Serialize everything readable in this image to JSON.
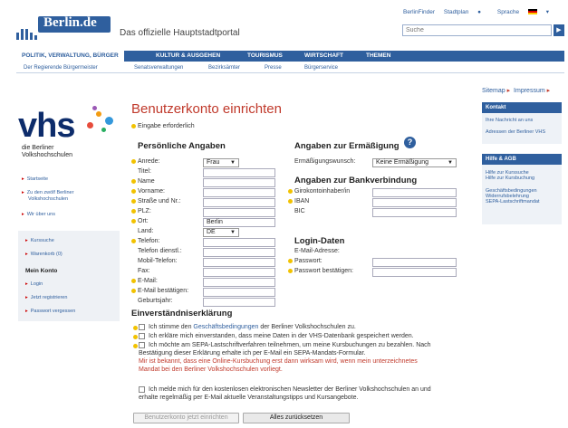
{
  "header": {
    "logo_text": "Berlin.de",
    "portal_title": "Das offizielle Hauptstadtportal",
    "util": {
      "berlinfinder": "BerlinFinder",
      "stadtplan": "Stadtplan",
      "sprache": "Sprache"
    },
    "search_placeholder": "Suche"
  },
  "nav_main": [
    "POLITIK, VERWALTUNG, BÜRGER",
    "KULTUR & AUSGEHEN",
    "TOURISMUS",
    "WIRTSCHAFT",
    "THEMEN"
  ],
  "nav_sub": [
    "Der Regierende Bürgermeister",
    "Senatsverwaltungen",
    "Bezirksämter",
    "Presse",
    "Bürgerservice"
  ],
  "left": {
    "logo": "vhs",
    "sub1": "die Berliner",
    "sub2": "Volkshochschulen",
    "links": [
      "Startseite",
      "Zu den zwölf Berliner",
      "Volkshochschulen",
      "Wir über uns"
    ],
    "links2": [
      "Kurssuche",
      "Warenkorb (0)"
    ],
    "konto_head": "Mein Konto",
    "konto_links": [
      "Login",
      "Jetzt registrieren",
      "Passwort vergessen"
    ]
  },
  "right": {
    "sitemap": "Sitemap",
    "impressum": "Impressum",
    "kontakt_head": "Kontakt",
    "kontakt_links": [
      "Ihre Nachricht an uns",
      "Adressen der Berliner VHS"
    ],
    "hilfe_head": "Hilfe & AGB",
    "hilfe_links": [
      "Hilfe zur Kurssuche",
      "Hilfe zur Kursbuchung",
      "Geschäftsbedingungen",
      "Widerrufsbelehrung",
      "SEPA-Lastschriftmandat"
    ]
  },
  "main": {
    "title": "Benutzerkonto einrichten",
    "required_note": "Eingabe erforderlich",
    "personal": {
      "title": "Persönliche Angaben",
      "anrede": "Anrede:",
      "anrede_value": "Frau",
      "titel": "Titel:",
      "name": "Name",
      "vorname": "Vorname:",
      "strasse": "Straße und Nr.:",
      "plz": "PLZ:",
      "ort": "Ort:",
      "ort_value": "Berlin",
      "land": "Land:",
      "land_value": "DE",
      "telefon": "Telefon:",
      "telefon_dienst": "Telefon dienstl.:",
      "mobil": "Mobil-Telefon:",
      "fax": "Fax:",
      "email": "E-Mail:",
      "email_confirm": "E-Mail bestätigen:",
      "geburt": "Geburtsjahr:"
    },
    "ermaessigung": {
      "title": "Angaben zur Ermäßigung",
      "label": "Ermäßigungswunsch:",
      "value": "Keine Ermäßigung"
    },
    "bank": {
      "title": "Angaben zur Bankverbindung",
      "inhaber": "Girokontoinhaber/in",
      "iban": "IBAN",
      "bic": "BIC"
    },
    "login": {
      "title": "Login-Daten",
      "email": "E-Mail-Adresse:",
      "pw": "Passwort:",
      "pw2": "Passwort bestätigen:"
    },
    "consent": {
      "title": "Einverständniserklärung",
      "c1_a": "Ich stimme den ",
      "c1_link": "Geschäftsbedingungen",
      "c1_b": " der Berliner Volkshochschulen zu.",
      "c2": "Ich erkläre mich einverstanden, dass meine Daten in der VHS-Datenbank gespeichert werden.",
      "c3_l1": "Ich möchte am SEPA-Lastschriftverfahren teilnehmen, um meine Kursbuchungen zu bezahlen. Nach",
      "c3_l2": "Bestätigung dieser Erklärung erhalte ich per E-Mail ein SEPA-Mandats-Formular.",
      "c3_l3": "Mir ist bekannt, dass eine Online-Kursbuchung erst dann wirksam wird, wenn mein unterzeichnetes",
      "c3_l4": "Mandat bei den Berliner Volkshochschulen vorliegt.",
      "c4_l1": "Ich melde mich für den kostenlosen elektronischen Newsletter der Berliner Volkshochschulen an und",
      "c4_l2": "erhalte regelmäßig per E-Mail aktuelle Veranstaltungstipps und Kursangebote."
    },
    "btn_submit": "Benutzerkonto jetzt einrichten",
    "btn_reset": "Alles zurücksetzen"
  },
  "colors": {
    "brand": "#2f5f9e",
    "title_red": "#c0392b",
    "required": "#f2c200"
  }
}
